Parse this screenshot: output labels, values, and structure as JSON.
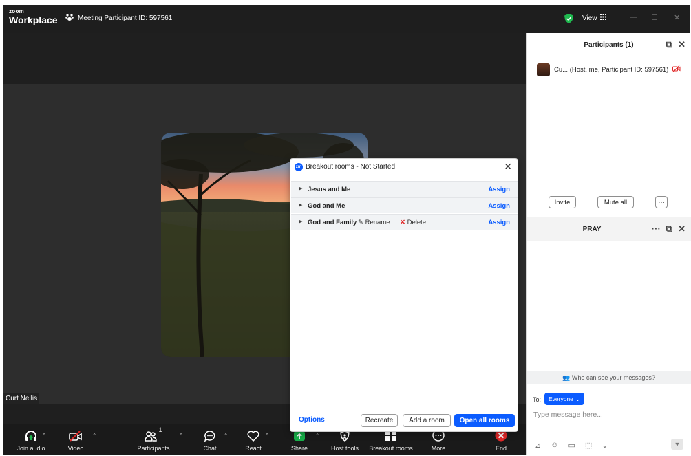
{
  "titlebar": {
    "logo_line1": "zoom",
    "logo_line2": "Workplace",
    "meeting_id": "Meeting Participant ID: 597561",
    "view_label": "View"
  },
  "stage": {
    "name_label": "Curt Nellis"
  },
  "breakout": {
    "title": "Breakout rooms - Not Started",
    "rooms": [
      {
        "name": "Jesus and Me",
        "assign": "Assign"
      },
      {
        "name": "God and Me",
        "assign": "Assign"
      },
      {
        "name": "God and Family",
        "assign": "Assign",
        "rename": "Rename",
        "delete": "Delete"
      }
    ],
    "options": "Options",
    "recreate": "Recreate",
    "add_room": "Add a room",
    "open_all": "Open all rooms"
  },
  "toolbar": {
    "join_audio": "Join audio",
    "video": "Video",
    "participants": "Participants",
    "participants_count": "1",
    "chat": "Chat",
    "react": "React",
    "share": "Share",
    "host_tools": "Host tools",
    "breakout_rooms": "Breakout rooms",
    "more": "More",
    "end": "End"
  },
  "participants_panel": {
    "title": "Participants (1)",
    "row_text": "Cu... (Host, me, Participant ID: 597561)",
    "invite": "Invite",
    "mute_all": "Mute all"
  },
  "chat_panel": {
    "title": "PRAY",
    "who_can_see": "Who can see your messages?",
    "to_label": "To:",
    "recipient": "Everyone",
    "placeholder": "Type message here..."
  },
  "colors": {
    "accent": "#0b5cff",
    "end_red": "#e02828",
    "share_green": "#18b04a"
  }
}
